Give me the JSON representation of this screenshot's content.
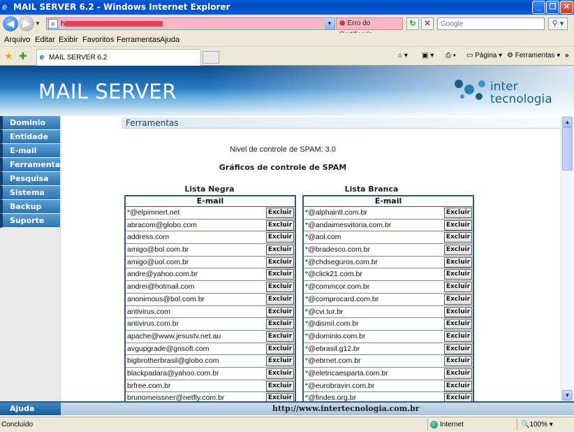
{
  "window": {
    "title": "MAIL SERVER 6.2 - Windows Internet Explorer",
    "min_icon": "minimize-icon",
    "max_icon": "maximize-icon",
    "close_icon": "close-icon"
  },
  "address": {
    "url_prefix": "h",
    "cert_error": "Erro do Certificado",
    "search_placeholder": "Google"
  },
  "menu": [
    "Arquivo",
    "Editar",
    "Exibir",
    "Favoritos",
    "Ferramentas",
    "Ajuda"
  ],
  "tab": {
    "label": "MAIL SERVER 6.2"
  },
  "commands": {
    "page": "Página",
    "tools": "Ferramentas"
  },
  "site": {
    "title": "MAIL SERVER",
    "logo_line1": "inter",
    "logo_line2": "tecnologia"
  },
  "nav": [
    "Dominio",
    "Entidade",
    "E-mail",
    "Ferramentas",
    "Pesquisa",
    "Sistema",
    "Backup",
    "Suporte"
  ],
  "section": "Ferramentas",
  "spam_level": "Nivel de controle de SPAM: 3.0",
  "graphs_title": "Gráficos de controle de SPAM",
  "blacklist": {
    "title": "Lista Negra",
    "column": "E-mail",
    "button": "Excluir",
    "entries": [
      "*@elpimnert.net",
      "abracom@globo.com",
      "address.com",
      "amigo@bol.com.br",
      "amigo@uol.com.br",
      "andre@yahoo.com.br",
      "andrei@hotmail.com",
      "anonimous@bol.com.br",
      "antivirus.com",
      "antivirus.com.br",
      "apache@www.jesustv.net.au",
      "avgupgrade@grisoft.com",
      "bigbrotherbrasil@globo.com",
      "blackpadara@yahoo.com.br",
      "brfree.com.br",
      "brunomeissner@netfly.com.br"
    ]
  },
  "whitelist": {
    "title": "Lista Branca",
    "column": "E-mail",
    "button": "Excluir",
    "entries": [
      "*@alphaintl.com.br",
      "*@andaimesvitoria.com.br",
      "*@aol.com",
      "*@bradesco.com.br",
      "*@chdseguros.com.br",
      "*@click21.com.br",
      "*@commcor.com.br",
      "*@comprocard.com.br",
      "*@cvi.tur.br",
      "*@dismil.com.br",
      "*@dominio.com.br",
      "*@ebrasil.g12.br",
      "*@ebrnet.com.br",
      "*@eletricaesparta.com.br",
      "*@eurobravin.com.br",
      "*@findes.org.br"
    ]
  },
  "footer": {
    "help": "Ajuda",
    "link": "http://www.intertecnologia.com.br"
  },
  "status": {
    "text": "Concluído",
    "zone": "Internet",
    "zoom": "100%"
  }
}
